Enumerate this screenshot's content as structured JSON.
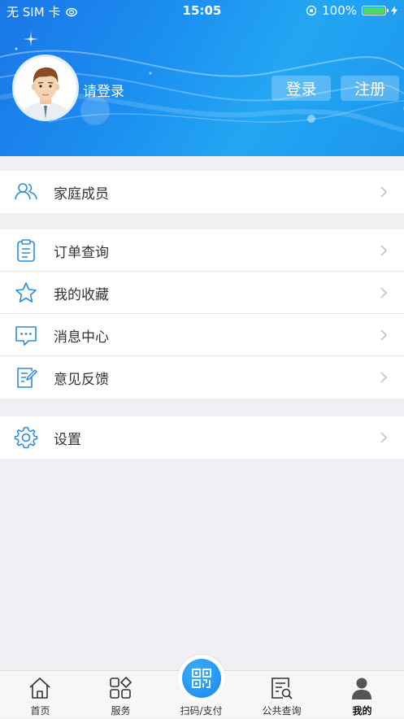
{
  "status_bar": {
    "carrier": "无 SIM 卡",
    "time": "15:05",
    "battery": "100%"
  },
  "profile": {
    "login_hint": "请登录",
    "login_button": "登录",
    "register_button": "注册"
  },
  "menu": {
    "group1": [
      {
        "label": "家庭成员",
        "icon": "family-members-icon"
      }
    ],
    "group2": [
      {
        "label": "订单查询",
        "icon": "clipboard-icon"
      },
      {
        "label": "我的收藏",
        "icon": "star-icon"
      },
      {
        "label": "消息中心",
        "icon": "chat-bubble-icon"
      },
      {
        "label": "意见反馈",
        "icon": "edit-note-icon"
      }
    ],
    "group3": [
      {
        "label": "设置",
        "icon": "gear-icon"
      }
    ]
  },
  "tabbar": {
    "items": [
      {
        "label": "首页",
        "icon": "home-icon"
      },
      {
        "label": "服务",
        "icon": "grid-icon"
      },
      {
        "label": "扫码/支付",
        "icon": "qr-code-icon"
      },
      {
        "label": "公共查询",
        "icon": "document-search-icon"
      },
      {
        "label": "我的",
        "icon": "user-icon"
      }
    ],
    "active": "我的"
  },
  "colors": {
    "accent": "#1b8df0",
    "icon_blue": "#2a8bd8",
    "background": "#efeff4"
  }
}
